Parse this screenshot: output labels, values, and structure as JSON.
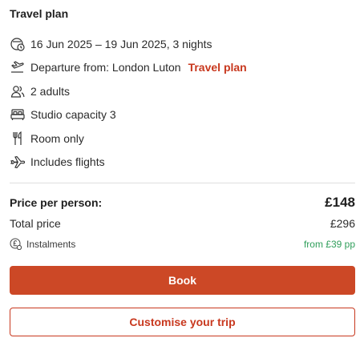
{
  "title": "Travel plan",
  "details": {
    "dates": "16 Jun 2025 – 19 Jun 2025, 3 nights",
    "departure": "Departure from: London Luton",
    "departure_link": "Travel plan",
    "guests": "2 adults",
    "room": "Studio capacity 3",
    "board": "Room only",
    "flights": "Includes flights"
  },
  "icons": {
    "dates": "calendar-clock-icon",
    "departure": "plane-departure-icon",
    "guests": "people-icon",
    "room": "bed-icon",
    "board": "fork-knife-icon",
    "flights": "plane-icon",
    "instalments": "pound-coin-icon"
  },
  "pricing": {
    "per_person_label": "Price per person:",
    "per_person_value": "£148",
    "total_label": "Total price",
    "total_value": "£296",
    "instalments_label": "Instalments",
    "instalments_value": "from £39 pp"
  },
  "actions": {
    "book_label": "Book",
    "customise_label": "Customise your trip"
  },
  "colors": {
    "accent": "#cc4826",
    "link": "#c8381e",
    "instalments": "#2f9e5a"
  }
}
